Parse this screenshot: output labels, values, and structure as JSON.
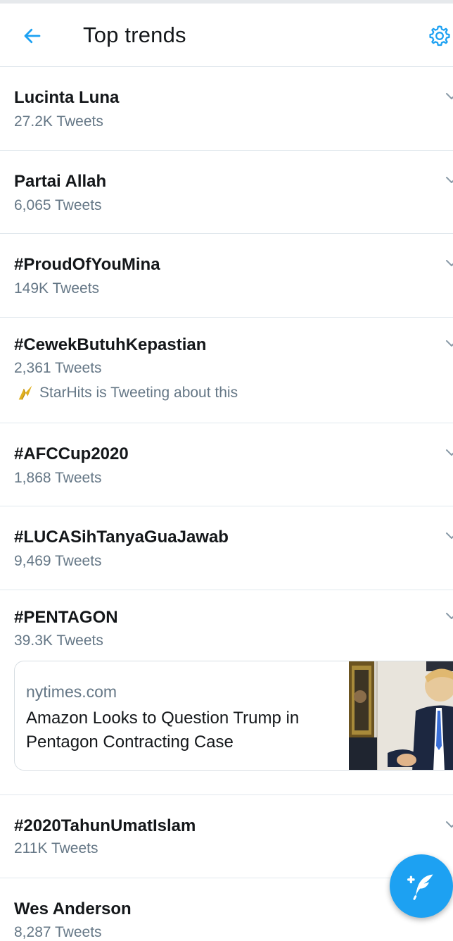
{
  "header": {
    "title": "Top trends",
    "back_icon": "arrow-left-icon",
    "settings_icon": "gear-icon"
  },
  "trends": [
    {
      "name": "Lucinta Luna",
      "count": "27.2K Tweets"
    },
    {
      "name": "Partai Allah",
      "count": "6,065 Tweets"
    },
    {
      "name": "#ProudOfYouMina",
      "count": "149K Tweets"
    },
    {
      "name": "#CewekButuhKepastian",
      "count": "2,361 Tweets",
      "context": "StarHits is Tweeting about this"
    },
    {
      "name": "#AFCCup2020",
      "count": "1,868 Tweets"
    },
    {
      "name": "#LUCASihTanyaGuaJawab",
      "count": "9,469 Tweets"
    },
    {
      "name": "#PENTAGON",
      "count": "39.3K Tweets"
    },
    {
      "name": "#2020TahunUmatIslam",
      "count": "211K Tweets"
    },
    {
      "name": "Wes Anderson",
      "count": "8,287 Tweets"
    }
  ],
  "news_card": {
    "source": "nytimes.com",
    "headline": "Amazon Looks to Question Trump in Pentagon Contracting Case"
  },
  "compose_icon": "compose-tweet-icon",
  "colors": {
    "accent": "#1da1f2",
    "primary_text": "#14171a",
    "secondary_text": "#657786",
    "divider": "#e1e8ed"
  }
}
